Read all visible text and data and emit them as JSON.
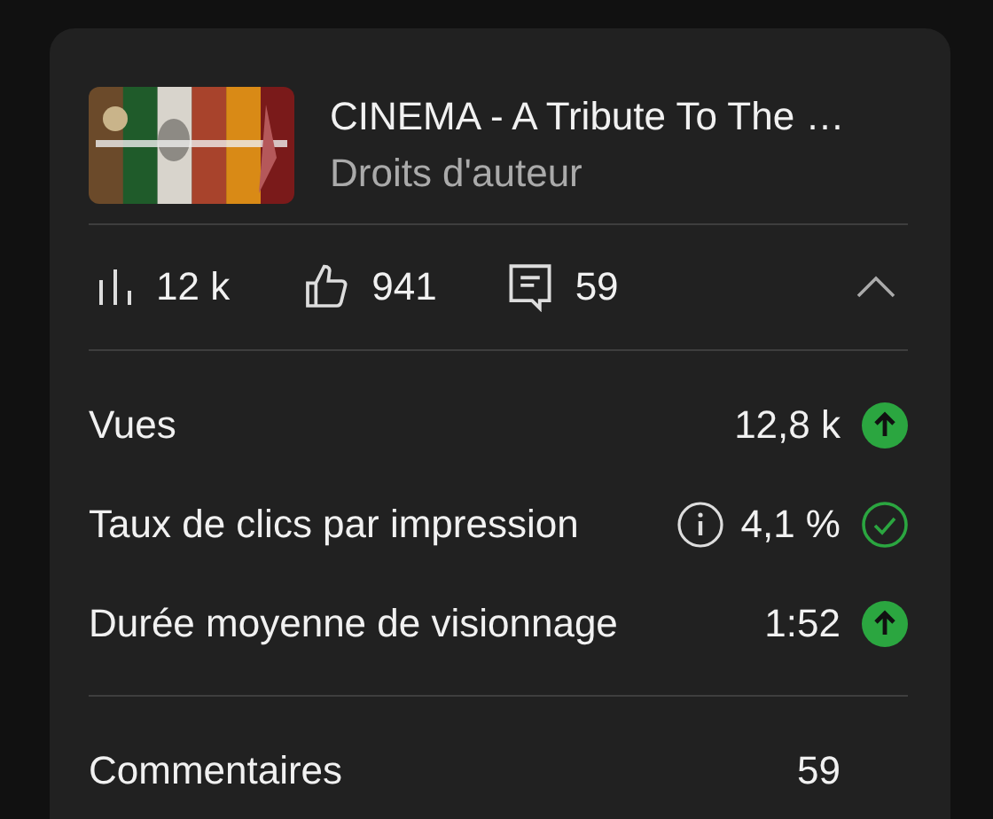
{
  "video": {
    "title": "CINEMA - A Tribute To The …",
    "subtitle": "Droits d'auteur"
  },
  "summary": {
    "expanded": true,
    "stats": [
      {
        "kind": "views",
        "value": "12 k"
      },
      {
        "kind": "likes",
        "value": "941"
      },
      {
        "kind": "comments",
        "value": "59"
      }
    ]
  },
  "metrics": [
    {
      "label": "Vues",
      "info": false,
      "value": "12,8 k",
      "kind": "up"
    },
    {
      "label": "Taux de clics par impression",
      "info": true,
      "value": "4,1 %",
      "kind": "check"
    },
    {
      "label": "Durée moyenne de visionnage",
      "info": false,
      "value": "1:52",
      "kind": "up"
    }
  ],
  "extra": [
    {
      "label": "Commentaires",
      "value": "59"
    }
  ]
}
